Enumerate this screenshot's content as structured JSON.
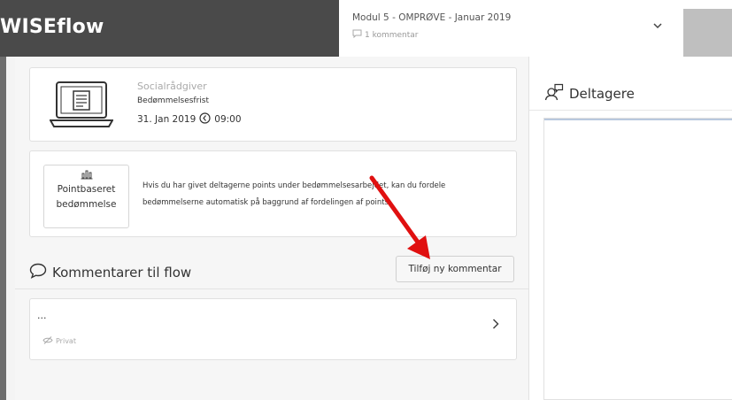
{
  "header": {
    "brand": "WISEflow",
    "module_title": "Modul 5 - OMPRØVE - Januar 2019",
    "comment_count": "1 kommentar"
  },
  "assessment": {
    "role": "Socialrådgiver",
    "deadline_label": "Bedømmelsesfrist",
    "deadline_date": "31. Jan 2019",
    "deadline_time": "09:00"
  },
  "points": {
    "button_line1": "Pointbaseret",
    "button_line2": "bedømmelse",
    "description_line1": "Hvis du har givet deltagerne points under bedømmelsesarbejdet, kan du fordele",
    "description_line2": "bedømmelserne automatisk på baggrund af fordelingen af points."
  },
  "comments": {
    "heading": "Kommentarer til flow",
    "add_button": "Tilføj ny kommentar",
    "item_text": "...",
    "item_visibility": "Privat"
  },
  "participants": {
    "heading": "Deltagere"
  },
  "colors": {
    "topbar": "#4a4a4a",
    "annotation_arrow": "#e01010"
  }
}
